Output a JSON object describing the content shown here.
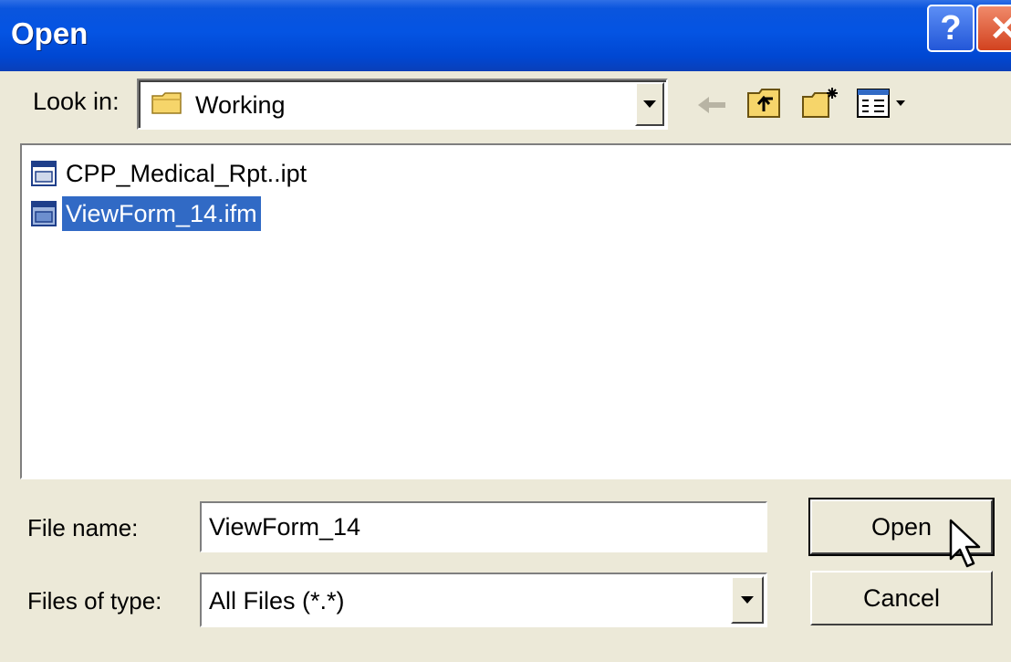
{
  "window": {
    "title": "Open",
    "help_glyph": "?",
    "close_glyph": "✕"
  },
  "lookin": {
    "label": "Look in:",
    "value": "Working",
    "icon": "folder-icon"
  },
  "toolbar": {
    "icons": [
      "back-arrow-icon",
      "up-folder-icon",
      "new-folder-icon",
      "view-menu-icon"
    ]
  },
  "files": [
    {
      "name": "CPP_Medical_Rpt..ipt",
      "icon": "form-file-icon",
      "selected": false
    },
    {
      "name": "ViewForm_14.ifm",
      "icon": "form-file-icon",
      "selected": true
    }
  ],
  "filename": {
    "label": "File name:",
    "value": "ViewForm_14"
  },
  "filetype": {
    "label": "Files of type:",
    "value": "All Files (*.*)"
  },
  "buttons": {
    "open": "Open",
    "cancel": "Cancel"
  },
  "colors": {
    "titlebar": "#0454e3",
    "dialog_bg": "#ece9d8",
    "selection": "#316ac5"
  }
}
